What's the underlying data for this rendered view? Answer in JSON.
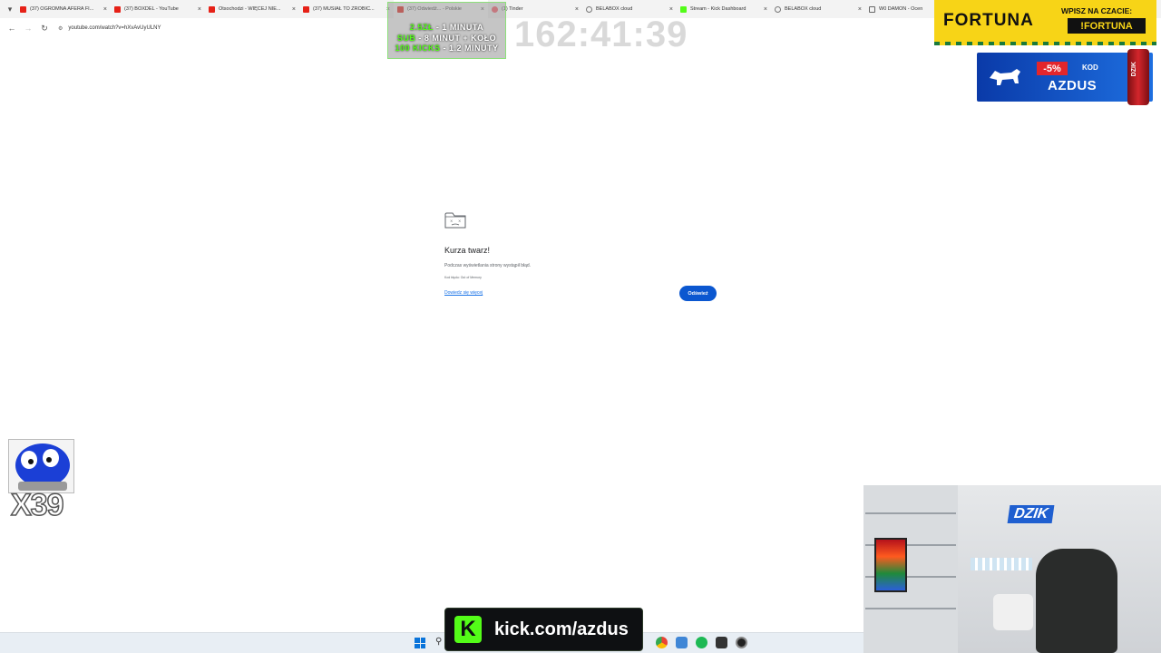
{
  "browser": {
    "tabs": [
      {
        "title": "(37) OGROMNA AFERA FI...",
        "favicon": "youtube-icon",
        "active": false
      },
      {
        "title": "(37) BOXDEL - YouTube",
        "favicon": "youtube-icon",
        "active": false
      },
      {
        "title": "Otsochodzi - WIĘCEJ NIE...",
        "favicon": "youtube-icon",
        "active": false
      },
      {
        "title": "(37) MUSIAŁ TO ZROBIĆ...",
        "favicon": "youtube-icon",
        "active": false
      },
      {
        "title": "(37) Odwiedź... - Polskie",
        "favicon": "youtube-icon",
        "active": true
      },
      {
        "title": "(1) Tinder",
        "favicon": "tinder-icon",
        "active": false
      },
      {
        "title": "BELABOX cloud",
        "favicon": "globe-icon",
        "active": false
      },
      {
        "title": "Stream - Kick Dashboard",
        "favicon": "kick-icon",
        "active": false
      },
      {
        "title": "BELABOX cloud",
        "favicon": "globe-icon",
        "active": false
      },
      {
        "title": "W0 DAMON - Ocen",
        "favicon": "document-icon",
        "active": false
      }
    ],
    "address": "youtube.com/watch?v=hXvAvUyULNY"
  },
  "crash_page": {
    "title": "Kurza twarz!",
    "message": "Podczas wyświetlania strony wystąpił błąd.",
    "error_code": "Kod błędu: Out of Memory",
    "learn_more": "Dowiedz się więcej",
    "reload": "Odśwież"
  },
  "overlay": {
    "goals": [
      {
        "highlight": "2.5ZŁ",
        "text": " - 1 MINUTA"
      },
      {
        "highlight": "SUB",
        "text": " - 8 MINUT + KOŁO"
      },
      {
        "highlight": "100 KICKS",
        "text": " - 1.2 MINUTY"
      }
    ],
    "timer": "162:41:39",
    "fortuna": {
      "logo": "FORTUNA",
      "cta": "WPISZ NA CZACIE:",
      "code": "!FORTUNA"
    },
    "promo": {
      "discount": "-5%",
      "kod_label": "KOD",
      "code": "AZDUS",
      "can_label": "DZIK"
    },
    "multiplier": "X39",
    "kick": {
      "logo": "K",
      "url": "kick.com/azdus"
    },
    "webcam_logo": "DZIK"
  },
  "colors": {
    "kick_green": "#53fc18",
    "fortuna_yellow": "#f7d417",
    "reload_blue": "#0b57d0",
    "promo_red": "#e3262b"
  }
}
